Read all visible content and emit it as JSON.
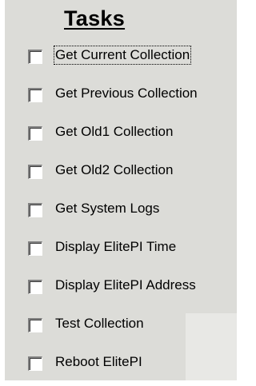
{
  "title": "Tasks",
  "tasks": [
    {
      "label": "Get Current Collection",
      "checked": false,
      "focused": true
    },
    {
      "label": "Get Previous Collection",
      "checked": false,
      "focused": false
    },
    {
      "label": "Get Old1 Collection",
      "checked": false,
      "focused": false
    },
    {
      "label": "Get Old2 Collection",
      "checked": false,
      "focused": false
    },
    {
      "label": "Get System Logs",
      "checked": false,
      "focused": false
    },
    {
      "label": "Display ElitePI Time",
      "checked": false,
      "focused": false
    },
    {
      "label": "Display ElitePI Address",
      "checked": false,
      "focused": false
    },
    {
      "label": "Test Collection",
      "checked": false,
      "focused": false
    },
    {
      "label": "Reboot ElitePI",
      "checked": false,
      "focused": false
    }
  ],
  "colors": {
    "panel_background": "#dcdcd8",
    "checkbox_background": "#ffffff",
    "text": "#000000"
  }
}
